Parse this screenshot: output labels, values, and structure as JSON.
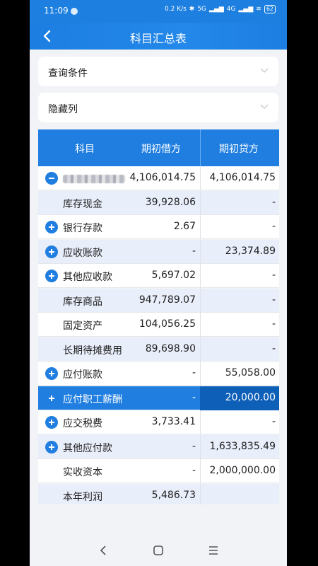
{
  "status_bar": {
    "time": "11:09",
    "network_label": "0.2 K/s",
    "signal_label": "5G",
    "signal_label_2": "4G",
    "battery": "62"
  },
  "nav": {
    "title": "科目汇总表"
  },
  "filters": {
    "query_label": "查询条件",
    "hidden_label": "隐藏列"
  },
  "table": {
    "headers": {
      "subject": "科目",
      "opening_debit": "期初借方",
      "opening_credit": "期初贷方"
    },
    "rows": [
      {
        "name": "",
        "debit": "4,106,014.75",
        "credit": "4,106,014.75",
        "expand": "minus",
        "shade": false,
        "selected": false
      },
      {
        "name": "库存现金",
        "debit": "39,928.06",
        "credit": "-",
        "expand": "none",
        "shade": true,
        "selected": false
      },
      {
        "name": "银行存款",
        "debit": "2.67",
        "credit": "-",
        "expand": "plus",
        "shade": false,
        "selected": false
      },
      {
        "name": "应收账款",
        "debit": "-",
        "credit": "23,374.89",
        "expand": "plus",
        "shade": true,
        "selected": false
      },
      {
        "name": "其他应收款",
        "debit": "5,697.02",
        "credit": "-",
        "expand": "plus",
        "shade": false,
        "selected": false
      },
      {
        "name": "库存商品",
        "debit": "947,789.07",
        "credit": "-",
        "expand": "none",
        "shade": true,
        "selected": false
      },
      {
        "name": "固定资产",
        "debit": "104,056.25",
        "credit": "-",
        "expand": "none",
        "shade": false,
        "selected": false
      },
      {
        "name": "长期待摊费用",
        "debit": "89,698.90",
        "credit": "-",
        "expand": "none",
        "shade": true,
        "selected": false
      },
      {
        "name": "应付账款",
        "debit": "-",
        "credit": "55,058.00",
        "expand": "plus",
        "shade": false,
        "selected": false
      },
      {
        "name": "应付职工薪酬",
        "debit": "-",
        "credit": "20,000.00",
        "expand": "plus",
        "shade": true,
        "selected": true
      },
      {
        "name": "应交税费",
        "debit": "3,733.41",
        "credit": "-",
        "expand": "plus",
        "shade": false,
        "selected": false
      },
      {
        "name": "其他应付款",
        "debit": "-",
        "credit": "1,633,835.49",
        "expand": "plus",
        "shade": true,
        "selected": false
      },
      {
        "name": "实收资本",
        "debit": "-",
        "credit": "2,000,000.00",
        "expand": "none",
        "shade": false,
        "selected": false
      },
      {
        "name": "本年利润",
        "debit": "5,486.73",
        "credit": "",
        "expand": "none",
        "shade": true,
        "selected": false
      }
    ]
  },
  "colors": {
    "primary": "#1f7ee0",
    "row_shade": "#e9eefb",
    "selected_credit": "#0d5fb8"
  },
  "icons": {
    "back": "chevron-left-icon",
    "collapse": "chevron-down-icon",
    "expand": "plus-circle-icon",
    "collapse_row": "minus-circle-icon"
  }
}
